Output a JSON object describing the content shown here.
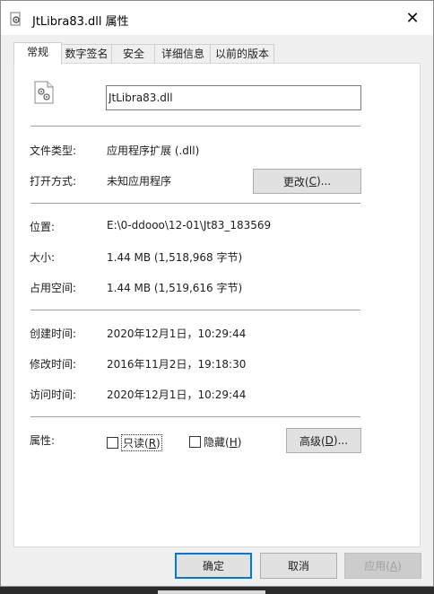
{
  "window": {
    "title": "JtLibra83.dll 属性",
    "close_glyph": "✕"
  },
  "tabs": [
    {
      "label": "常规",
      "active": true
    },
    {
      "label": "数字签名"
    },
    {
      "label": "安全"
    },
    {
      "label": "详细信息"
    },
    {
      "label": "以前的版本"
    }
  ],
  "general": {
    "file_name": "JtLibra83.dll",
    "file_type_label": "文件类型:",
    "file_type_value": "应用程序扩展 (.dll)",
    "opens_with_label": "打开方式:",
    "opens_with_value": "未知应用程序",
    "change_button": {
      "text": "更改(",
      "key": "C",
      "suffix": ")..."
    },
    "location_label": "位置:",
    "location_value": "E:\\0-ddooo\\12-01\\Jt83_183569",
    "size_label": "大小:",
    "size_value": "1.44 MB (1,518,968 字节)",
    "size_on_disk_label": "占用空间:",
    "size_on_disk_value": "1.44 MB (1,519,616 字节)",
    "created_label": "创建时间:",
    "created_value": "2020年12月1日，10:29:44",
    "modified_label": "修改时间:",
    "modified_value": "2016年11月2日，19:18:30",
    "accessed_label": "访问时间:",
    "accessed_value": "2020年12月1日，10:29:44",
    "attributes_label": "属性:",
    "readonly": {
      "text": "只读(",
      "key": "R",
      "suffix": ")",
      "checked": false
    },
    "hidden": {
      "text": "隐藏(",
      "key": "H",
      "suffix": ")",
      "checked": false
    },
    "advanced_button": {
      "text": "高级(",
      "key": "D",
      "suffix": ")..."
    }
  },
  "footer": {
    "ok": "确定",
    "cancel": "取消",
    "apply": {
      "text": "应用(",
      "key": "A",
      "suffix": ")"
    }
  },
  "colors": {
    "accent": "#0078d7",
    "window_bg": "#f0f0f0",
    "panel_bg": "#ffffff"
  }
}
